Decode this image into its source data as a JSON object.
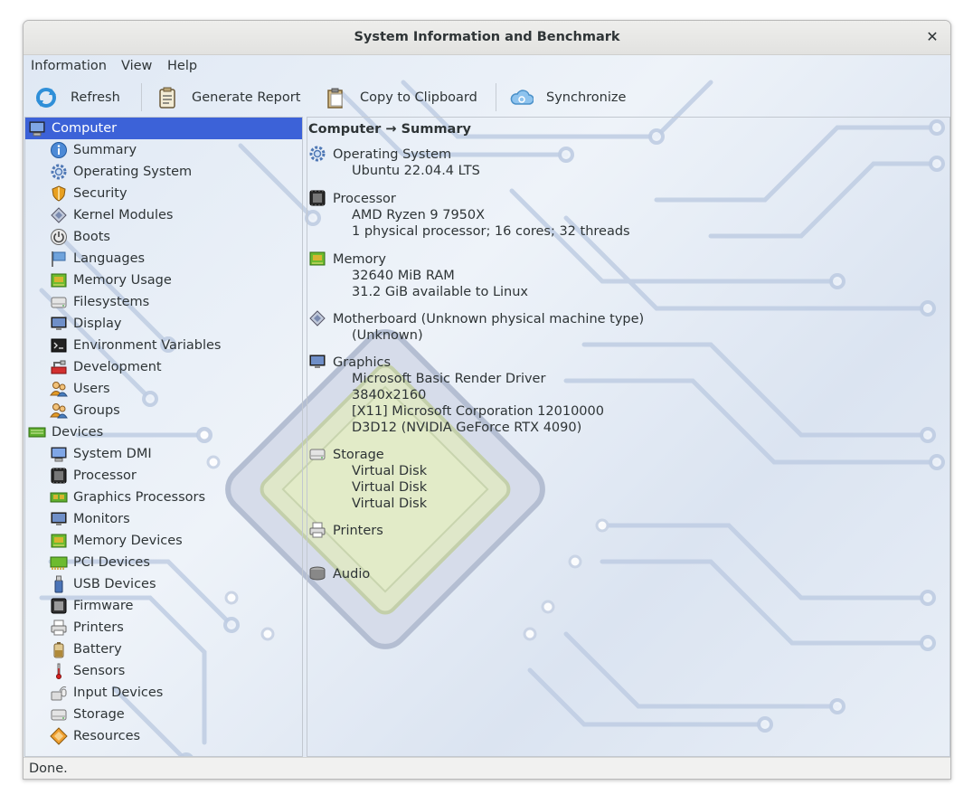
{
  "window": {
    "title": "System Information and Benchmark",
    "close_glyph": "✕"
  },
  "menubar": [
    "Information",
    "View",
    "Help"
  ],
  "toolbar": {
    "refresh": {
      "label": "Refresh",
      "icon": "refresh-icon"
    },
    "report": {
      "label": "Generate Report",
      "icon": "report-icon"
    },
    "clipboard": {
      "label": "Copy to Clipboard",
      "icon": "clipboard-icon"
    },
    "sync": {
      "label": "Synchronize",
      "icon": "cloud-sync-icon"
    }
  },
  "sidebar": {
    "computer": {
      "label": "Computer",
      "items": [
        "Summary",
        "Operating System",
        "Security",
        "Kernel Modules",
        "Boots",
        "Languages",
        "Memory Usage",
        "Filesystems",
        "Display",
        "Environment Variables",
        "Development",
        "Users",
        "Groups"
      ]
    },
    "devices": {
      "label": "Devices",
      "items": [
        "System DMI",
        "Processor",
        "Graphics Processors",
        "Monitors",
        "Memory Devices",
        "PCI Devices",
        "USB Devices",
        "Firmware",
        "Printers",
        "Battery",
        "Sensors",
        "Input Devices",
        "Storage",
        "Resources"
      ]
    }
  },
  "content": {
    "heading": "Computer → Summary",
    "sections": [
      {
        "title": "Operating System",
        "icon": "gear-icon",
        "lines": [
          "Ubuntu 22.04.4 LTS"
        ]
      },
      {
        "title": "Processor",
        "icon": "cpu-icon",
        "lines": [
          "AMD Ryzen 9 7950X",
          "1 physical processor; 16 cores; 32 threads"
        ]
      },
      {
        "title": "Memory",
        "icon": "memory-icon",
        "lines": [
          "32640 MiB RAM",
          "31.2 GiB available to Linux"
        ]
      },
      {
        "title": "Motherboard (Unknown physical machine type)",
        "icon": "motherboard-icon",
        "lines": [
          "(Unknown)"
        ]
      },
      {
        "title": "Graphics",
        "icon": "monitor-icon",
        "lines": [
          "Microsoft Basic Render Driver",
          "3840x2160",
          "[X11] Microsoft Corporation 12010000",
          "D3D12 (NVIDIA GeForce RTX 4090)"
        ]
      },
      {
        "title": "Storage",
        "icon": "drive-icon",
        "lines": [
          "Virtual Disk",
          "Virtual Disk",
          "Virtual Disk"
        ]
      },
      {
        "title": "Printers",
        "icon": "printer-icon",
        "lines": []
      },
      {
        "title": "Audio",
        "icon": "audio-icon",
        "lines": []
      }
    ]
  },
  "status": "Done.",
  "colors": {
    "selection": "#3c62d8",
    "background_tint": "#e3ebf5"
  }
}
